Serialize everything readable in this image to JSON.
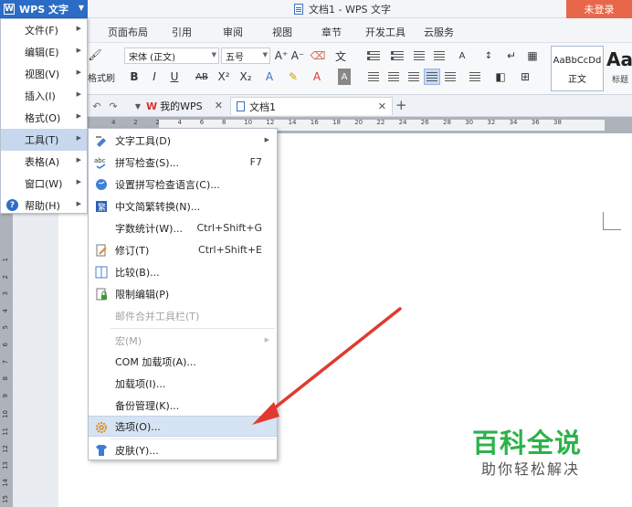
{
  "app": {
    "name": "WPS 文字",
    "window_title": "文档1 - WPS 文字",
    "login": "未登录"
  },
  "ribbon_tabs": [
    "页面布局",
    "引用",
    "审阅",
    "视图",
    "章节",
    "开发工具",
    "云服务"
  ],
  "ribbon": {
    "font_name": "宋体 (正文)",
    "font_size": "五号",
    "format_painter": "格式刷",
    "style_sample": "AaBbCcDd",
    "style_name": "正文",
    "style_big": "Aa",
    "style_big_name": "标题"
  },
  "doc_tabs": {
    "home": "我的WPS",
    "current": "文档1"
  },
  "ruler": {
    "h_ticks": [
      "4",
      "2",
      "2",
      "4",
      "6",
      "8",
      "10",
      "12",
      "14",
      "16",
      "18",
      "20",
      "22",
      "24",
      "26",
      "28",
      "30",
      "32",
      "34",
      "36",
      "38"
    ],
    "v_ticks": [
      "1",
      "2",
      "3",
      "4",
      "5",
      "6",
      "7",
      "8",
      "9",
      "10",
      "11",
      "12",
      "13",
      "14",
      "15"
    ]
  },
  "main_menu": [
    {
      "label": "文件(F)"
    },
    {
      "label": "编辑(E)"
    },
    {
      "label": "视图(V)"
    },
    {
      "label": "插入(I)"
    },
    {
      "label": "格式(O)"
    },
    {
      "label": "工具(T)"
    },
    {
      "label": "表格(A)"
    },
    {
      "label": "窗口(W)"
    },
    {
      "label": "帮助(H)"
    }
  ],
  "tools_menu": [
    {
      "label": "文字工具(D)",
      "shortcut": "",
      "icon": "text-tools-icon"
    },
    {
      "label": "拼写检查(S)...",
      "shortcut": "F7",
      "icon": "spellcheck-icon"
    },
    {
      "label": "设置拼写检查语言(C)...",
      "shortcut": "",
      "icon": "globe-icon"
    },
    {
      "label": "中文简繁转换(N)...",
      "shortcut": "",
      "icon": "chinese-convert-icon"
    },
    {
      "label": "字数统计(W)...",
      "shortcut": "Ctrl+Shift+G",
      "icon": ""
    },
    {
      "label": "修订(T)",
      "shortcut": "Ctrl+Shift+E",
      "icon": "track-changes-icon"
    },
    {
      "label": "比较(B)...",
      "shortcut": "",
      "icon": "compare-icon"
    },
    {
      "label": "限制编辑(P)",
      "shortcut": "",
      "icon": "lock-icon"
    },
    {
      "label": "邮件合并工具栏(T)",
      "shortcut": "",
      "icon": ""
    },
    {
      "label": "宏(M)",
      "shortcut": "",
      "icon": ""
    },
    {
      "label": "COM 加载项(A)...",
      "shortcut": "",
      "icon": ""
    },
    {
      "label": "加载项(I)...",
      "shortcut": "",
      "icon": ""
    },
    {
      "label": "备份管理(K)...",
      "shortcut": "",
      "icon": ""
    },
    {
      "label": "选项(O)...",
      "shortcut": "",
      "icon": "gear-icon"
    },
    {
      "label": "皮肤(Y)...",
      "shortcut": "",
      "icon": "tshirt-icon"
    }
  ],
  "watermark": {
    "main": "百科全说",
    "sub": "助你轻松解决"
  },
  "colors": {
    "accent": "#2b6cc4",
    "login": "#e8664a",
    "arrow": "#e03a30",
    "watermark": "#2db24a"
  }
}
